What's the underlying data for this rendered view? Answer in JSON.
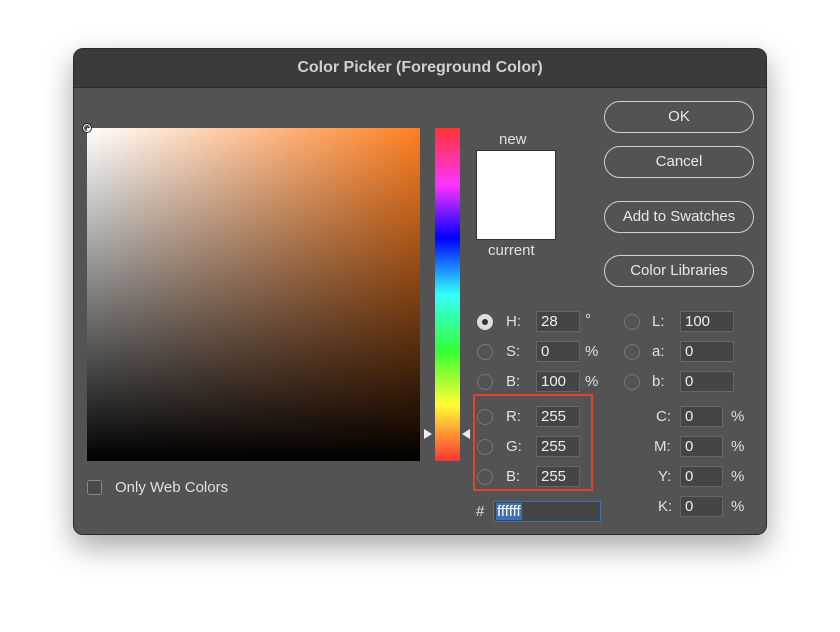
{
  "title": "Color Picker (Foreground Color)",
  "buttons": {
    "ok": "OK",
    "cancel": "Cancel",
    "add": "Add to Swatches",
    "libraries": "Color Libraries"
  },
  "swatch": {
    "new_label": "new",
    "current_label": "current",
    "new_color": "#ffffff",
    "current_color": "#ffffff"
  },
  "hsb": {
    "h_label": "H:",
    "h": "28",
    "h_unit": "°",
    "s_label": "S:",
    "s": "0",
    "s_unit": "%",
    "b_label": "B:",
    "b": "100",
    "b_unit": "%",
    "selected": "H"
  },
  "rgb": {
    "r_label": "R:",
    "r": "255",
    "g_label": "G:",
    "g": "255",
    "b_label": "B:",
    "b": "255"
  },
  "lab": {
    "l_label": "L:",
    "l": "100",
    "a_label": "a:",
    "a": "0",
    "b_label": "b:",
    "b": "0"
  },
  "cmyk": {
    "c_label": "C:",
    "c": "0",
    "m_label": "M:",
    "m": "0",
    "y_label": "Y:",
    "y": "0",
    "k_label": "K:",
    "k": "0",
    "unit": "%"
  },
  "hex": {
    "label": "#",
    "value": "ffffff"
  },
  "only_web_colors": {
    "label": "Only Web Colors",
    "checked": false
  },
  "colors": {
    "hue_base": "#ff7f22",
    "highlight": "#e0452a",
    "selection": "#3d6fb5"
  }
}
